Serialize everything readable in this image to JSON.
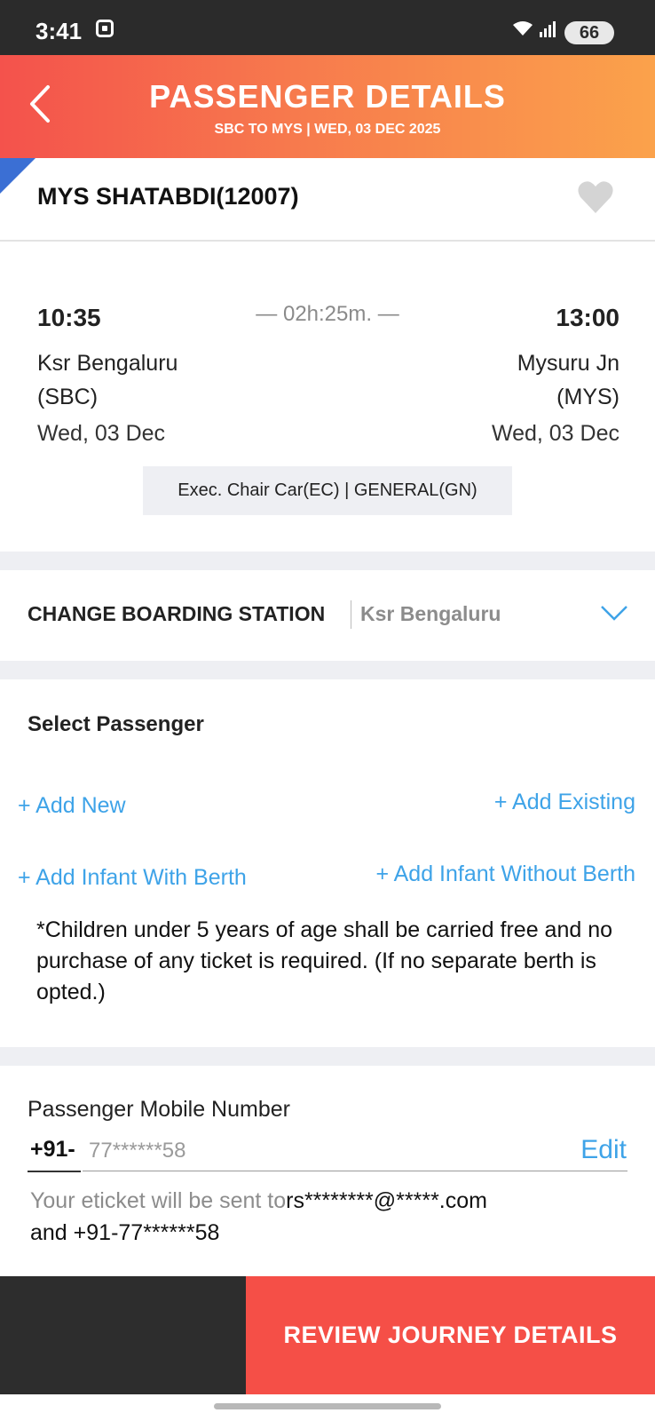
{
  "status_bar": {
    "time": "3:41",
    "battery": "66"
  },
  "header": {
    "title": "PASSENGER DETAILS",
    "subtitle": "SBC TO MYS |  WED, 03 DEC  2025"
  },
  "train": {
    "name": "MYS SHATABDI(12007)"
  },
  "journey": {
    "departure_time": "10:35",
    "arrival_time": "13:00",
    "duration": "— 02h:25m. —",
    "departure_station": "Ksr Bengaluru",
    "departure_code": "(SBC)",
    "arrival_station": "Mysuru Jn",
    "arrival_code": "(MYS)",
    "departure_date": "Wed, 03 Dec",
    "arrival_date": "Wed, 03 Dec",
    "class_quota": "Exec. Chair Car(EC) | GENERAL(GN)"
  },
  "boarding": {
    "label": "CHANGE BOARDING STATION",
    "value": "Ksr Bengaluru"
  },
  "passenger": {
    "heading": "Select Passenger",
    "add_new": "+ Add New",
    "add_existing": "+ Add Existing",
    "add_infant_with_berth": "+ Add Infant With Berth",
    "add_infant_without_berth": "+ Add Infant Without Berth",
    "note": "*Children under 5 years of age shall be carried free and no purchase of any ticket is required. (If no separate berth is opted.)"
  },
  "mobile": {
    "label": "Passenger Mobile Number",
    "country_code": "+91-",
    "number": "77******58",
    "edit": "Edit",
    "info_prefix": "Your eticket will be sent to",
    "info_email": "rs********@*****.com",
    "info_line2": "and +91-77******58"
  },
  "footer": {
    "review_button": "REVIEW JOURNEY DETAILS"
  },
  "colors": {
    "header_start": "#f4524c",
    "header_end": "#fba24b",
    "link": "#3ea3e8",
    "primary_button": "#f54f47",
    "corner_accent": "#3b6fd4"
  }
}
